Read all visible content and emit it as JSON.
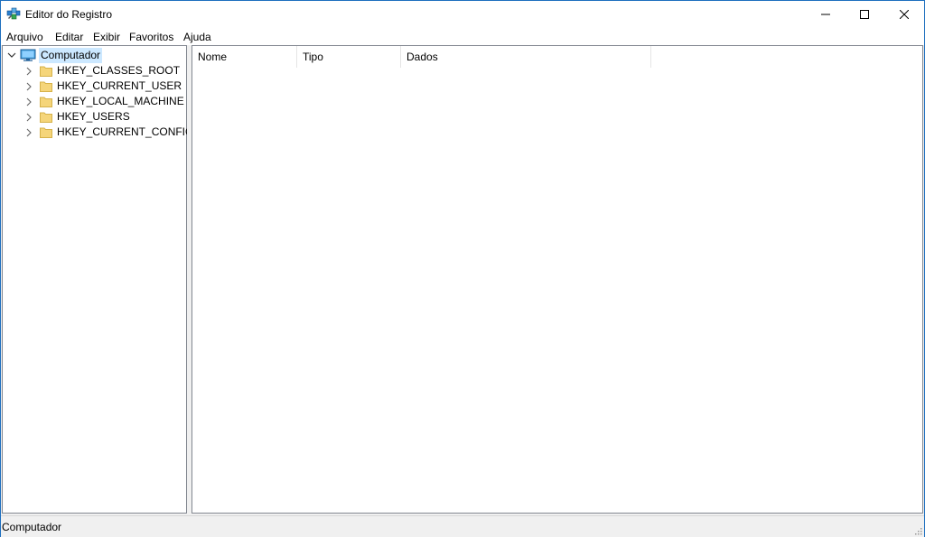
{
  "window": {
    "title": "Editor do Registro",
    "icon": "regedit-icon"
  },
  "caption_buttons": {
    "minimize_icon": "minimize-icon",
    "maximize_icon": "maximize-icon",
    "close_icon": "close-icon"
  },
  "menu": [
    "Arquivo",
    "Editar",
    "Exibir",
    "Favoritos",
    "Ajuda"
  ],
  "tree": {
    "root": {
      "label": "Computador",
      "expanded": true,
      "selected": true,
      "icon": "computer-icon"
    },
    "children": [
      {
        "label": "HKEY_CLASSES_ROOT",
        "icon": "folder-icon"
      },
      {
        "label": "HKEY_CURRENT_USER",
        "icon": "folder-icon"
      },
      {
        "label": "HKEY_LOCAL_MACHINE",
        "icon": "folder-icon"
      },
      {
        "label": "HKEY_USERS",
        "icon": "folder-icon"
      },
      {
        "label": "HKEY_CURRENT_CONFIG",
        "icon": "folder-icon"
      }
    ]
  },
  "list": {
    "columns": [
      "Nome",
      "Tipo",
      "Dados"
    ],
    "rows": []
  },
  "status": {
    "path": "Computador"
  },
  "colors": {
    "selection": "#cce8ff",
    "folder": "#f5d57a",
    "window_border": "#1e6fbf"
  }
}
